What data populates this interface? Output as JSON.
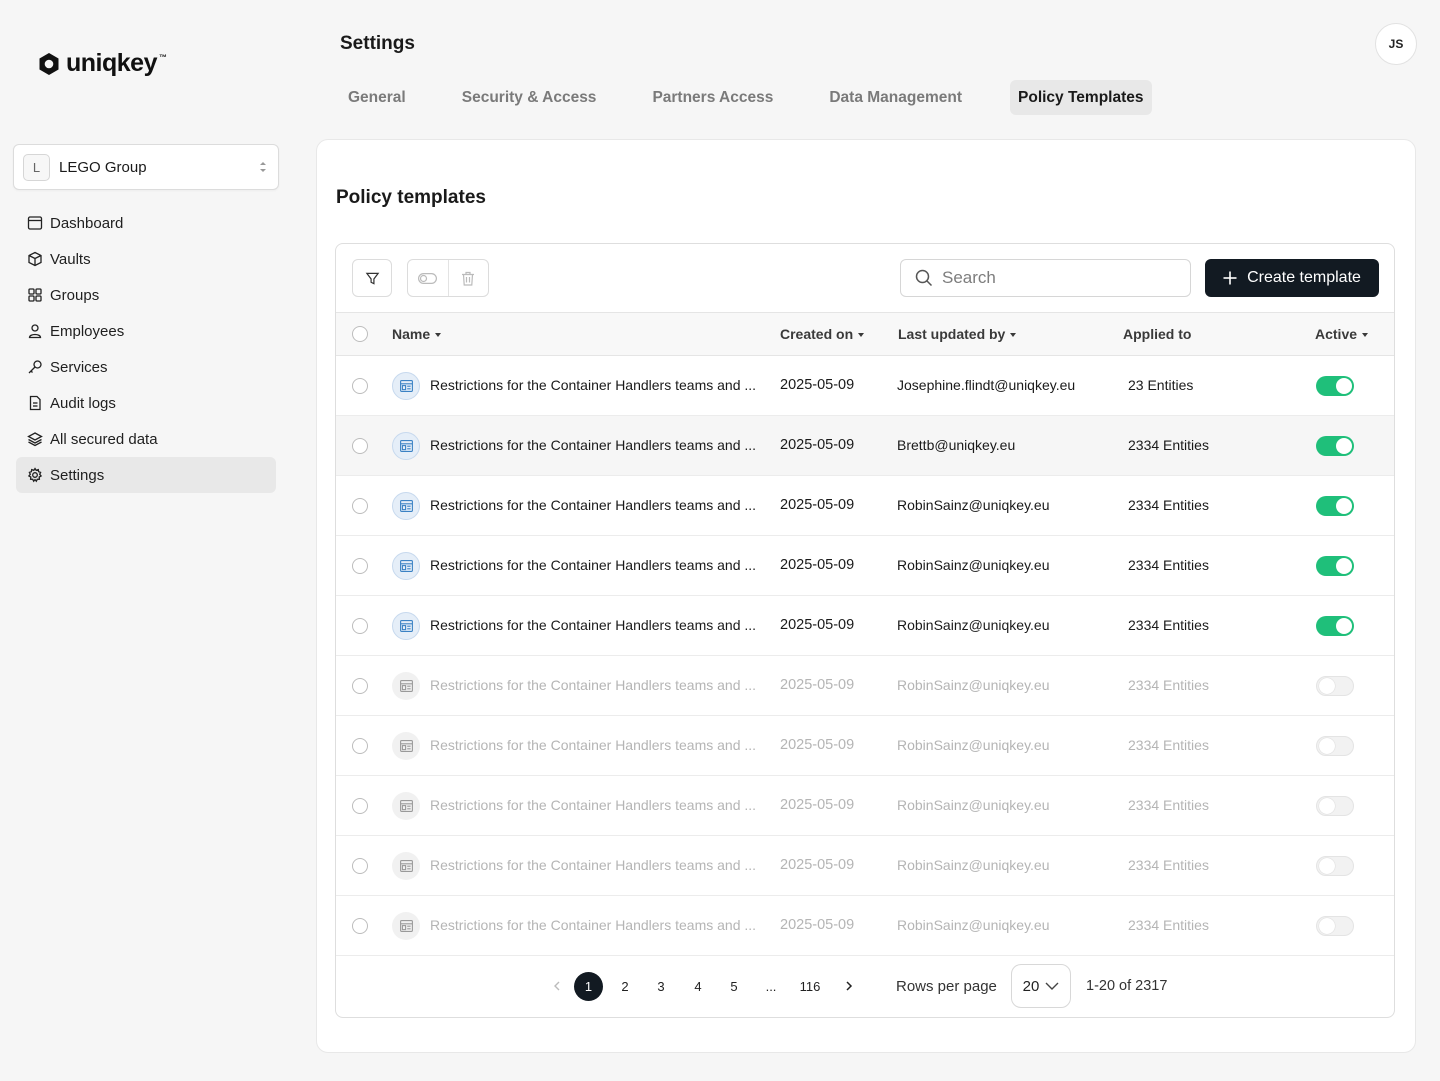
{
  "brand": {
    "name": "uniqkey",
    "tm": "™"
  },
  "org": {
    "initial": "L",
    "name": "LEGO Group"
  },
  "nav": [
    {
      "label": "Dashboard",
      "icon": "dashboard-icon"
    },
    {
      "label": "Vaults",
      "icon": "cube-icon"
    },
    {
      "label": "Groups",
      "icon": "grid-icon"
    },
    {
      "label": "Employees",
      "icon": "user-icon"
    },
    {
      "label": "Services",
      "icon": "key-icon"
    },
    {
      "label": "Audit logs",
      "icon": "document-icon"
    },
    {
      "label": "All secured data",
      "icon": "layers-icon"
    },
    {
      "label": "Settings",
      "icon": "gear-icon",
      "active": true
    }
  ],
  "header": {
    "title": "Settings",
    "avatar": "JS",
    "tabs": [
      "General",
      "Security & Access",
      "Partners Access",
      "Data Management",
      "Policy Templates"
    ],
    "active_tab": "Policy Templates"
  },
  "card": {
    "title": "Policy templates"
  },
  "toolbar": {
    "search_placeholder": "Search",
    "create_label": "Create template"
  },
  "table": {
    "columns": {
      "name": "Name",
      "created": "Created on",
      "updated_by": "Last updated by",
      "applied": "Applied to",
      "active": "Active"
    },
    "rows": [
      {
        "name": "Restrictions for the Container Handlers teams and ...",
        "created": "2025-05-09",
        "updated_by": "Josephine.flindt@uniqkey.eu",
        "applied": "23 Entities",
        "active": true
      },
      {
        "name": "Restrictions for the Container Handlers teams and ...",
        "created": "2025-05-09",
        "updated_by": "Brettb@uniqkey.eu",
        "applied": "2334 Entities",
        "active": true
      },
      {
        "name": "Restrictions for the Container Handlers teams and ...",
        "created": "2025-05-09",
        "updated_by": "RobinSainz@uniqkey.eu",
        "applied": "2334 Entities",
        "active": true
      },
      {
        "name": "Restrictions for the Container Handlers teams and ...",
        "created": "2025-05-09",
        "updated_by": "RobinSainz@uniqkey.eu",
        "applied": "2334 Entities",
        "active": true
      },
      {
        "name": "Restrictions for the Container Handlers teams and ...",
        "created": "2025-05-09",
        "updated_by": "RobinSainz@uniqkey.eu",
        "applied": "2334 Entities",
        "active": true
      },
      {
        "name": "Restrictions for the Container Handlers teams and ...",
        "created": "2025-05-09",
        "updated_by": "RobinSainz@uniqkey.eu",
        "applied": "2334 Entities",
        "active": false
      },
      {
        "name": "Restrictions for the Container Handlers teams and ...",
        "created": "2025-05-09",
        "updated_by": "RobinSainz@uniqkey.eu",
        "applied": "2334 Entities",
        "active": false
      },
      {
        "name": "Restrictions for the Container Handlers teams and ...",
        "created": "2025-05-09",
        "updated_by": "RobinSainz@uniqkey.eu",
        "applied": "2334 Entities",
        "active": false
      },
      {
        "name": "Restrictions for the Container Handlers teams and ...",
        "created": "2025-05-09",
        "updated_by": "RobinSainz@uniqkey.eu",
        "applied": "2334 Entities",
        "active": false
      },
      {
        "name": "Restrictions for the Container Handlers teams and ...",
        "created": "2025-05-09",
        "updated_by": "RobinSainz@uniqkey.eu",
        "applied": "2334 Entities",
        "active": false
      }
    ]
  },
  "pagination": {
    "pages": [
      "1",
      "2",
      "3",
      "4",
      "5",
      "...",
      "116"
    ],
    "current": "1",
    "rows_per_page_label": "Rows per page",
    "rows_per_page": "20",
    "range": "1-20 of 2317"
  },
  "colors": {
    "accent_dark": "#121a22",
    "toggle_on": "#1fbf7a",
    "row_icon_blue": "#3b82c4"
  }
}
